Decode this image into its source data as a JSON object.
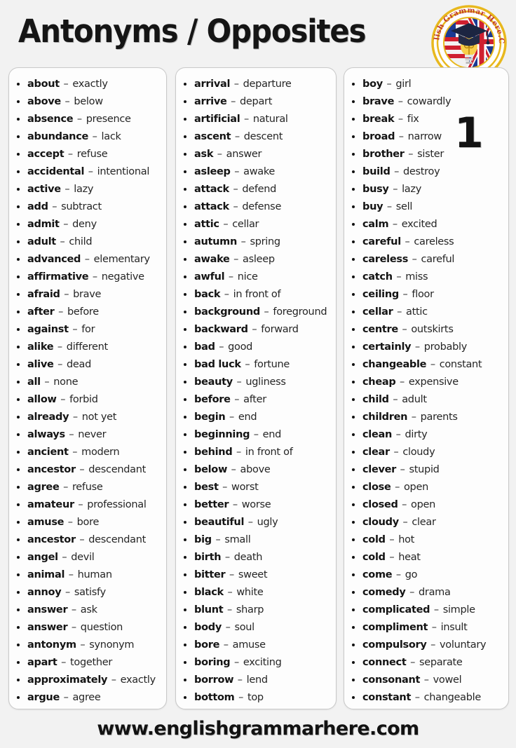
{
  "header": {
    "title": "Antonyms / Opposites",
    "logo": {
      "name": "english-grammar-here-logo",
      "text": "English Grammar Here.Com",
      "ring_color": "#e8b81e",
      "text_color": "#c0392b",
      "center_colors": [
        "#1b3a93",
        "#cf2030",
        "#ffffff",
        "#f5c518"
      ]
    }
  },
  "page_number": "1",
  "columns": [
    {
      "name": "column-1",
      "items": [
        {
          "word": "about",
          "opposite": "exactly"
        },
        {
          "word": "above",
          "opposite": "below"
        },
        {
          "word": "absence",
          "opposite": "presence"
        },
        {
          "word": "abundance",
          "opposite": "lack"
        },
        {
          "word": "accept",
          "opposite": "refuse"
        },
        {
          "word": "accidental",
          "opposite": "intentional"
        },
        {
          "word": "active",
          "opposite": "lazy"
        },
        {
          "word": "add",
          "opposite": "subtract"
        },
        {
          "word": "admit",
          "opposite": "deny"
        },
        {
          "word": "adult",
          "opposite": "child"
        },
        {
          "word": "advanced",
          "opposite": "elementary"
        },
        {
          "word": "affirmative",
          "opposite": "negative"
        },
        {
          "word": "afraid",
          "opposite": "brave"
        },
        {
          "word": "after",
          "opposite": "before"
        },
        {
          "word": "against",
          "opposite": "for"
        },
        {
          "word": "alike",
          "opposite": "different"
        },
        {
          "word": "alive",
          "opposite": "dead"
        },
        {
          "word": "all",
          "opposite": "none"
        },
        {
          "word": "allow",
          "opposite": "forbid"
        },
        {
          "word": "already",
          "opposite": "not yet"
        },
        {
          "word": "always",
          "opposite": "never"
        },
        {
          "word": "ancient",
          "opposite": "modern"
        },
        {
          "word": "ancestor",
          "opposite": "descendant"
        },
        {
          "word": "agree",
          "opposite": "refuse"
        },
        {
          "word": "amateur",
          "opposite": "professional"
        },
        {
          "word": "amuse",
          "opposite": "bore"
        },
        {
          "word": "ancestor",
          "opposite": "descendant"
        },
        {
          "word": "angel",
          "opposite": "devil"
        },
        {
          "word": "animal",
          "opposite": "human"
        },
        {
          "word": "annoy",
          "opposite": "satisfy"
        },
        {
          "word": "answer",
          "opposite": "ask"
        },
        {
          "word": "answer",
          "opposite": "question"
        },
        {
          "word": "antonym",
          "opposite": "synonym"
        },
        {
          "word": "apart",
          "opposite": "together"
        },
        {
          "word": "approximately",
          "opposite": "exactly"
        },
        {
          "word": "argue",
          "opposite": "agree"
        }
      ]
    },
    {
      "name": "column-2",
      "items": [
        {
          "word": "arrival",
          "opposite": "departure"
        },
        {
          "word": "arrive",
          "opposite": "depart"
        },
        {
          "word": "artificial",
          "opposite": "natural"
        },
        {
          "word": "ascent",
          "opposite": "descent"
        },
        {
          "word": "ask",
          "opposite": "answer"
        },
        {
          "word": "asleep",
          "opposite": "awake"
        },
        {
          "word": "attack",
          "opposite": "defend"
        },
        {
          "word": "attack",
          "opposite": "defense"
        },
        {
          "word": "attic",
          "opposite": "cellar"
        },
        {
          "word": "autumn",
          "opposite": "spring"
        },
        {
          "word": "awake",
          "opposite": "asleep"
        },
        {
          "word": "awful",
          "opposite": "nice"
        },
        {
          "word": "back",
          "opposite": "in front of"
        },
        {
          "word": "background",
          "opposite": "foreground"
        },
        {
          "word": "backward",
          "opposite": "forward"
        },
        {
          "word": "bad",
          "opposite": "good"
        },
        {
          "word": "bad luck",
          "opposite": "fortune"
        },
        {
          "word": "beauty",
          "opposite": "ugliness"
        },
        {
          "word": "before",
          "opposite": "after"
        },
        {
          "word": "begin",
          "opposite": "end"
        },
        {
          "word": "beginning",
          "opposite": "end"
        },
        {
          "word": "behind",
          "opposite": "in front of"
        },
        {
          "word": "below",
          "opposite": "above"
        },
        {
          "word": "best",
          "opposite": "worst"
        },
        {
          "word": "better",
          "opposite": "worse"
        },
        {
          "word": "beautiful",
          "opposite": "ugly"
        },
        {
          "word": "big",
          "opposite": "small"
        },
        {
          "word": "birth",
          "opposite": "death"
        },
        {
          "word": "bitter",
          "opposite": "sweet"
        },
        {
          "word": "black",
          "opposite": "white"
        },
        {
          "word": "blunt",
          "opposite": "sharp"
        },
        {
          "word": "body",
          "opposite": "soul"
        },
        {
          "word": "bore",
          "opposite": "amuse"
        },
        {
          "word": "boring",
          "opposite": "exciting"
        },
        {
          "word": "borrow",
          "opposite": "lend"
        },
        {
          "word": "bottom",
          "opposite": "top"
        }
      ]
    },
    {
      "name": "column-3",
      "items": [
        {
          "word": "boy",
          "opposite": "girl"
        },
        {
          "word": "brave",
          "opposite": "cowardly"
        },
        {
          "word": "break",
          "opposite": "fix"
        },
        {
          "word": "broad",
          "opposite": "narrow"
        },
        {
          "word": "brother",
          "opposite": "sister"
        },
        {
          "word": "build",
          "opposite": "destroy"
        },
        {
          "word": "busy",
          "opposite": "lazy"
        },
        {
          "word": "buy",
          "opposite": "sell"
        },
        {
          "word": "calm",
          "opposite": "excited"
        },
        {
          "word": "careful",
          "opposite": "careless"
        },
        {
          "word": "careless",
          "opposite": "careful"
        },
        {
          "word": "catch",
          "opposite": "miss"
        },
        {
          "word": "ceiling",
          "opposite": "floor"
        },
        {
          "word": "cellar",
          "opposite": "attic"
        },
        {
          "word": "centre",
          "opposite": "outskirts"
        },
        {
          "word": "certainly",
          "opposite": "probably"
        },
        {
          "word": "changeable",
          "opposite": "constant"
        },
        {
          "word": "cheap",
          "opposite": "expensive"
        },
        {
          "word": "child",
          "opposite": "adult"
        },
        {
          "word": "children",
          "opposite": "parents"
        },
        {
          "word": "clean",
          "opposite": "dirty"
        },
        {
          "word": "clear",
          "opposite": "cloudy"
        },
        {
          "word": "clever",
          "opposite": "stupid"
        },
        {
          "word": "close",
          "opposite": "open"
        },
        {
          "word": "closed",
          "opposite": "open"
        },
        {
          "word": "cloudy",
          "opposite": "clear"
        },
        {
          "word": "cold",
          "opposite": "hot"
        },
        {
          "word": "cold",
          "opposite": "heat"
        },
        {
          "word": "come",
          "opposite": "go"
        },
        {
          "word": "comedy",
          "opposite": "drama"
        },
        {
          "word": "complicated",
          "opposite": "simple"
        },
        {
          "word": "compliment",
          "opposite": "insult"
        },
        {
          "word": "compulsory",
          "opposite": "voluntary"
        },
        {
          "word": "connect",
          "opposite": "separate"
        },
        {
          "word": "consonant",
          "opposite": "vowel"
        },
        {
          "word": "constant",
          "opposite": "changeable"
        }
      ]
    }
  ],
  "separator": "–",
  "footer": {
    "url": "www.englishgrammarhere.com"
  }
}
